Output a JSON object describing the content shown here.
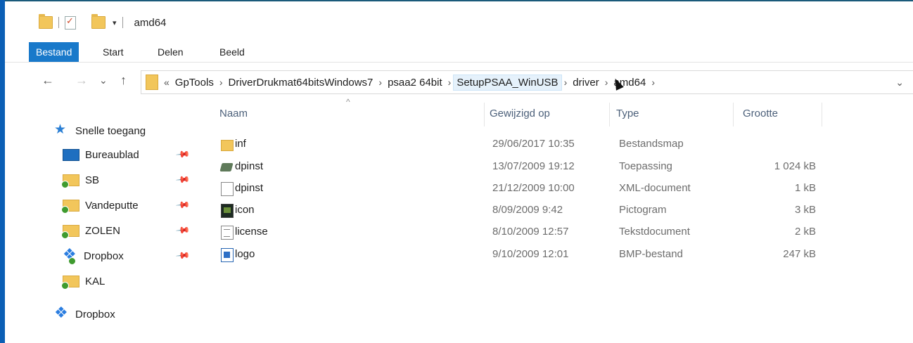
{
  "window": {
    "title": "amd64"
  },
  "ribbon": {
    "tabs": [
      "Bestand",
      "Start",
      "Delen",
      "Beeld"
    ]
  },
  "nav": {
    "back": "←",
    "forward": "→",
    "recent": "⌄",
    "up": "↑"
  },
  "address": {
    "lead": "«",
    "crumbs": [
      "GpTools",
      "DriverDrukmat64bitsWindows7",
      "psaa2 64bit",
      "SetupPSAA_WinUSB",
      "driver",
      "amd64"
    ],
    "sep": "›",
    "dropdown": "⌄"
  },
  "navpane": {
    "quick_access": "Snelle toegang",
    "items": [
      {
        "label": "Bureaublad",
        "icon": "desktop-icon",
        "pinned": true
      },
      {
        "label": "SB",
        "icon": "folder-icon",
        "pinned": true
      },
      {
        "label": "Vandeputte",
        "icon": "folder-icon",
        "pinned": true
      },
      {
        "label": "ZOLEN",
        "icon": "folder-icon",
        "pinned": true
      },
      {
        "label": "Dropbox",
        "icon": "dropbox-icon",
        "pinned": true
      },
      {
        "label": "KAL",
        "icon": "folder-icon",
        "pinned": false
      }
    ],
    "dropbox": "Dropbox",
    "pin_glyph": "📌"
  },
  "columns": {
    "name": "Naam",
    "date": "Gewijzigd op",
    "type": "Type",
    "size": "Grootte",
    "sort_glyph": "^"
  },
  "files": [
    {
      "name": "inf",
      "date": "29/06/2017 10:35",
      "type": "Bestandsmap",
      "size": "",
      "icon": "folder-icon"
    },
    {
      "name": "dpinst",
      "date": "13/07/2009 19:12",
      "type": "Toepassing",
      "size": "1 024 kB",
      "icon": "application-icon"
    },
    {
      "name": "dpinst",
      "date": "21/12/2009 10:00",
      "type": "XML-document",
      "size": "1 kB",
      "icon": "xml-document-icon"
    },
    {
      "name": "icon",
      "date": "8/09/2009 9:42",
      "type": "Pictogram",
      "size": "3 kB",
      "icon": "pictogram-icon"
    },
    {
      "name": "license",
      "date": "8/10/2009 12:57",
      "type": "Tekstdocument",
      "size": "2 kB",
      "icon": "text-document-icon"
    },
    {
      "name": "logo",
      "date": "9/10/2009 12:01",
      "type": "BMP-bestand",
      "size": "247 kB",
      "icon": "bmp-image-icon"
    }
  ]
}
